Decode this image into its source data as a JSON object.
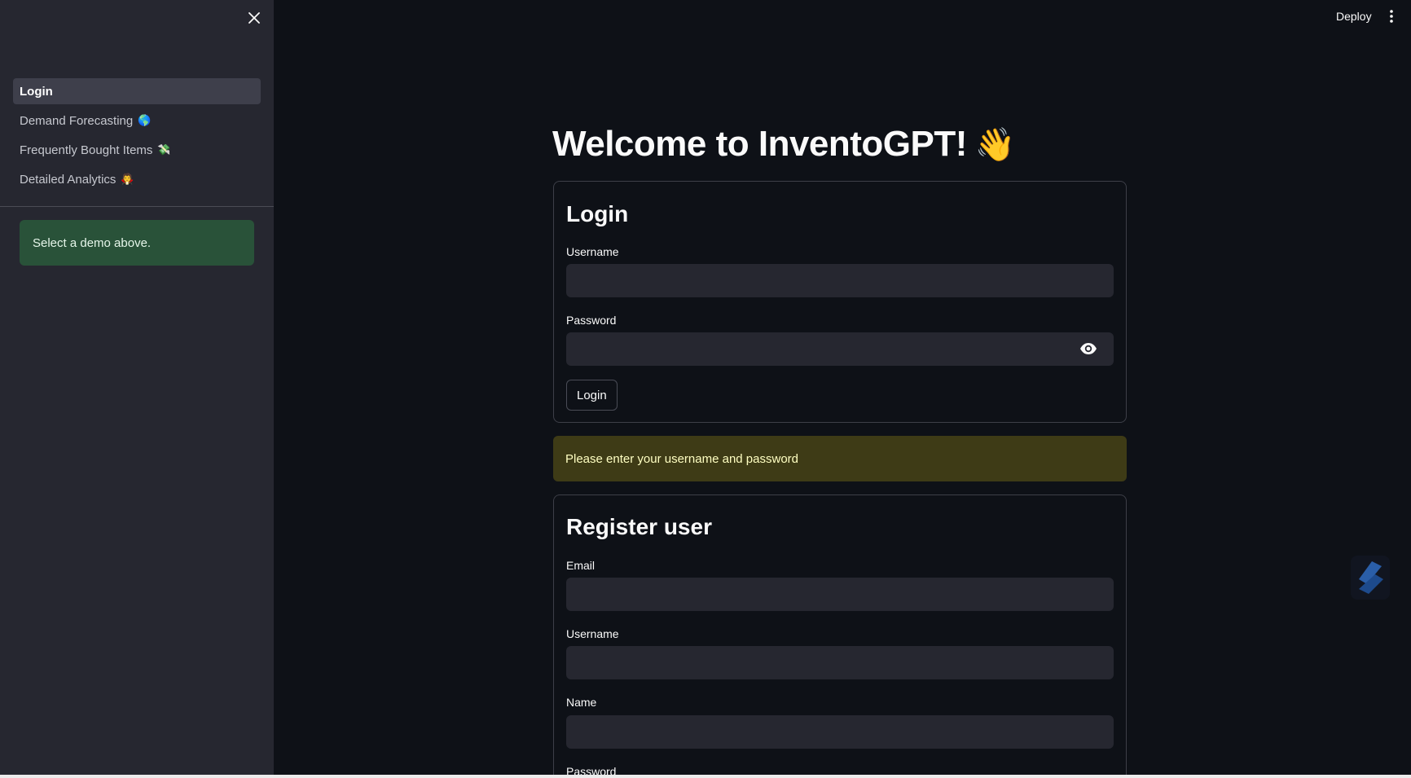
{
  "sidebar": {
    "nav_items": [
      {
        "label": "Login",
        "emoji": "",
        "active": true
      },
      {
        "label": "Demand Forecasting",
        "emoji": "🌎"
      },
      {
        "label": "Frequently Bought Items",
        "emoji": "💸"
      },
      {
        "label": "Detailed Analytics",
        "emoji": "🧛"
      }
    ],
    "info_message": "Select a demo above."
  },
  "topbar": {
    "deploy_label": "Deploy"
  },
  "main": {
    "title": "Welcome to InventoGPT!",
    "title_emoji": "👋",
    "login_form": {
      "heading": "Login",
      "username_label": "Username",
      "username_value": "",
      "password_label": "Password",
      "password_value": "",
      "submit_label": "Login"
    },
    "warning_message": "Please enter your username and password",
    "register_form": {
      "heading": "Register user",
      "email_label": "Email",
      "email_value": "",
      "username_label": "Username",
      "username_value": "",
      "name_label": "Name",
      "name_value": "",
      "password_label": "Password"
    }
  },
  "colors": {
    "app_background": "#0e1117",
    "sidebar_background": "#262730",
    "info_background": "#295239",
    "warning_background": "#3e3b16"
  }
}
